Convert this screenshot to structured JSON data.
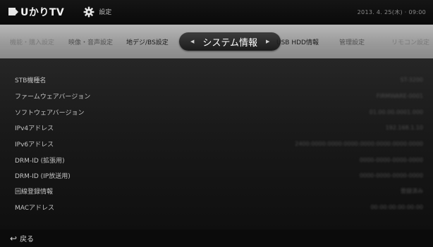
{
  "header": {
    "logo_text": "UかりTV",
    "settings_label": "設定",
    "datetime": "2013. 4. 25(木) · 09:00"
  },
  "tabs": [
    {
      "label": "機能・購入設定",
      "state": "faded"
    },
    {
      "label": "映像・音声設定",
      "state": "faded"
    },
    {
      "label": "地デジ/BS設定",
      "state": "normal"
    },
    {
      "label": "システム情報",
      "state": "active"
    },
    {
      "label": "USB HDD情報",
      "state": "normal"
    },
    {
      "label": "管理設定",
      "state": "faded"
    },
    {
      "label": "リモコン設定",
      "state": "faded"
    }
  ],
  "info": {
    "rows": [
      {
        "label": "STB機種名",
        "value": "ST-3200"
      },
      {
        "label": "ファームウェアバージョン",
        "value": "FIRMWARE-0001"
      },
      {
        "label": "ソフトウェアバージョン",
        "value": "01.00.00.0001.000"
      },
      {
        "label": "IPv4アドレス",
        "value": "192.168.1.10"
      },
      {
        "label": "IPv6アドレス",
        "value": "2400:0000:0000:0000:0000:0000:0000:0000"
      },
      {
        "label": "DRM-ID (拡張用)",
        "value": "0000-0000-0000-0000"
      },
      {
        "label": "DRM-ID (IP放送用)",
        "value": "0000-0000-0000-0000"
      },
      {
        "label": "回線登録情報",
        "value": "登録済み"
      },
      {
        "label": "MACアドレス",
        "value": "00:00:00:00:00:00"
      }
    ]
  },
  "footer": {
    "back_label": "戻る"
  },
  "colors": {
    "tabstrip": "#9c9c9c",
    "active_tab": "#2a2a2a",
    "background": "#0b0b0b"
  }
}
